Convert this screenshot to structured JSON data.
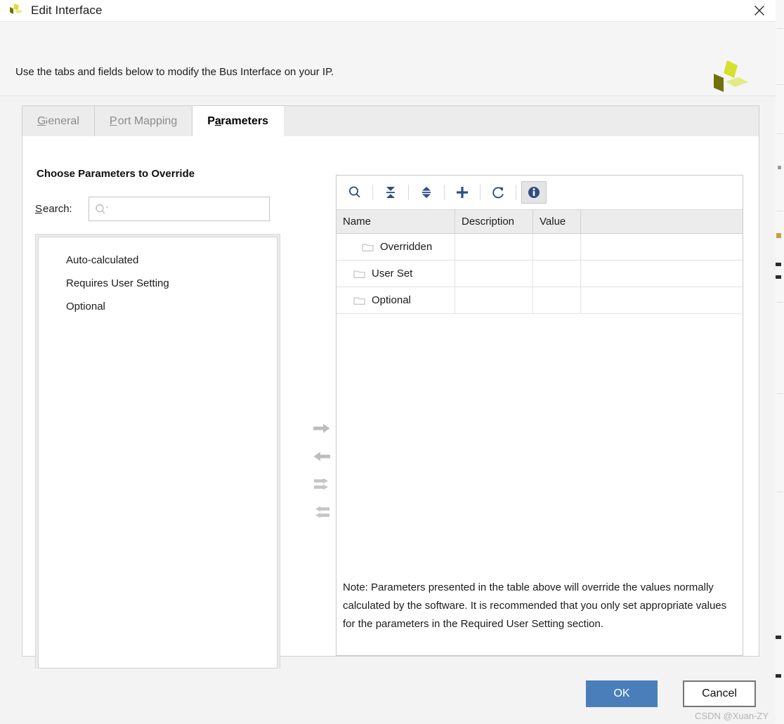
{
  "window": {
    "title": "Edit Interface",
    "logo_icon": "pinwheel-logo",
    "close_icon": "close-icon"
  },
  "header": {
    "description": "Use the tabs and fields below to modify the Bus Interface on your IP.",
    "brand_icon": "pinwheel-logo-large"
  },
  "tabs": [
    {
      "label": "General",
      "mnemonic": "G",
      "active": false
    },
    {
      "label": "Port Mapping",
      "mnemonic": "P",
      "active": false
    },
    {
      "label": "Parameters",
      "mnemonic": "a",
      "active": true
    }
  ],
  "left_panel": {
    "section_title": "Choose Parameters to Override",
    "search_label": "Search:",
    "search_mnemonic": "S",
    "search_value": "",
    "search_placeholder": "",
    "search_icon": "search-icon",
    "items": [
      "Auto-calculated",
      "Requires User Setting",
      "Optional"
    ]
  },
  "transfer_buttons": [
    {
      "name": "move-right-button",
      "icon": "arrow-right-icon"
    },
    {
      "name": "move-left-button",
      "icon": "arrow-left-icon"
    },
    {
      "name": "move-all-right-button",
      "icon": "double-arrow-right-icon"
    },
    {
      "name": "move-all-left-button",
      "icon": "double-arrow-left-icon"
    }
  ],
  "right_panel": {
    "toolbar": [
      {
        "name": "search-button",
        "icon": "search-icon",
        "selected": false
      },
      {
        "name": "collapse-all-button",
        "icon": "collapse-all-icon",
        "selected": false
      },
      {
        "name": "expand-all-button",
        "icon": "expand-all-icon",
        "selected": false
      },
      {
        "name": "add-button",
        "icon": "plus-icon",
        "selected": false
      },
      {
        "name": "refresh-button",
        "icon": "refresh-icon",
        "selected": false
      },
      {
        "name": "info-button",
        "icon": "info-icon",
        "selected": true
      }
    ],
    "table": {
      "columns": [
        "Name",
        "Description",
        "Value",
        ""
      ],
      "rows": [
        {
          "name": "Overridden",
          "description": "",
          "value": "",
          "icon": "folder-icon",
          "indent": 2
        },
        {
          "name": "User Set",
          "description": "",
          "value": "",
          "icon": "folder-icon",
          "indent": 1
        },
        {
          "name": "Optional",
          "description": "",
          "value": "",
          "icon": "folder-icon",
          "indent": 1
        }
      ]
    },
    "note": "Note: Parameters presented in the table above will override the values normally calculated by the software. It is recommended that you only set appropriate values for the parameters in the Required User Setting section."
  },
  "footer": {
    "ok_label": "OK",
    "cancel_label": "Cancel",
    "watermark": "CSDN @Xuan-ZY"
  },
  "colors": {
    "accent_blue": "#4a7ebb",
    "toolbar_icon": "#2e4f82",
    "logo_bright": "#d6e02e",
    "logo_dark": "#6e7208",
    "logo_pale": "#e3eb85"
  }
}
